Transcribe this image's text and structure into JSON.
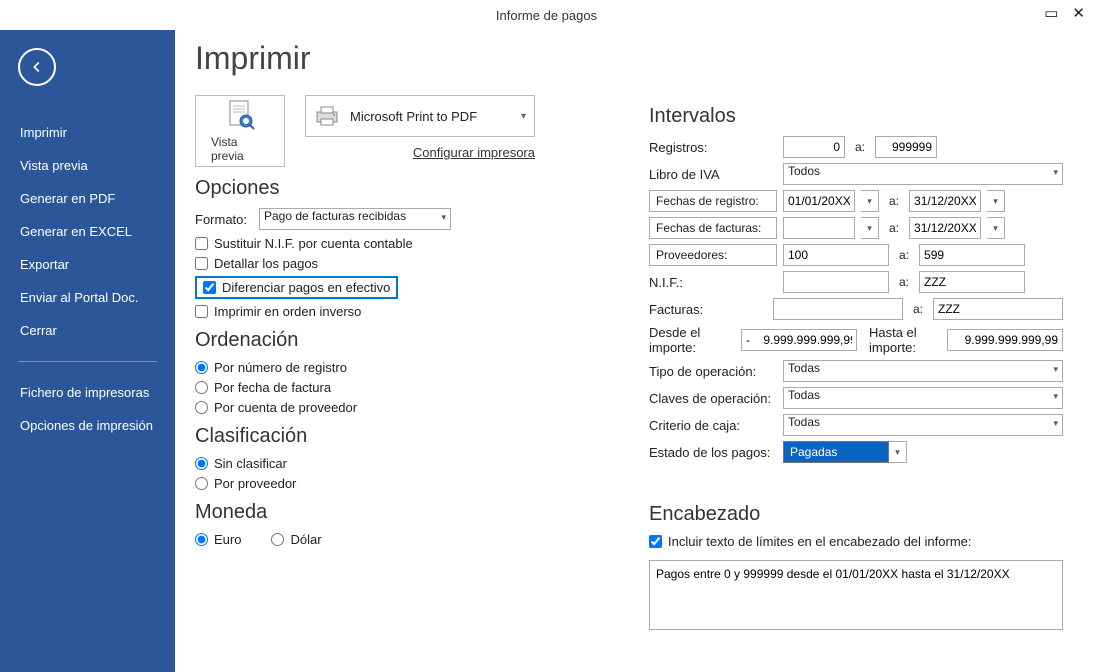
{
  "window": {
    "title": "Informe de pagos"
  },
  "sidebar": {
    "items": [
      {
        "label": "Imprimir"
      },
      {
        "label": "Vista previa"
      },
      {
        "label": "Generar en PDF"
      },
      {
        "label": "Generar en EXCEL"
      },
      {
        "label": "Exportar"
      },
      {
        "label": "Enviar al Portal Doc."
      },
      {
        "label": "Cerrar"
      }
    ],
    "items2": [
      {
        "label": "Fichero de impresoras"
      },
      {
        "label": "Opciones de impresión"
      }
    ]
  },
  "main": {
    "title": "Imprimir",
    "preview_label": "Vista previa",
    "printer": "Microsoft Print to PDF",
    "config_link": "Configurar impresora"
  },
  "opciones": {
    "heading": "Opciones",
    "formato_label": "Formato:",
    "formato_value": "Pago de facturas recibidas",
    "sustituir": "Sustituir N.I.F. por cuenta contable",
    "detallar": "Detallar los pagos",
    "diferenciar": "Diferenciar pagos en efectivo",
    "inverso": "Imprimir en orden inverso"
  },
  "ordenacion": {
    "heading": "Ordenación",
    "r1": "Por número de registro",
    "r2": "Por fecha de factura",
    "r3": "Por cuenta de proveedor"
  },
  "clasificacion": {
    "heading": "Clasificación",
    "r1": "Sin clasificar",
    "r2": "Por proveedor"
  },
  "moneda": {
    "heading": "Moneda",
    "r1": "Euro",
    "r2": "Dólar"
  },
  "intervalos": {
    "heading": "Intervalos",
    "registros_label": "Registros:",
    "registros_from": "0",
    "registros_to": "999999",
    "libro_label": "Libro de IVA",
    "libro_value": "Todos",
    "fechas_reg_btn": "Fechas de registro:",
    "fechas_reg_from": "01/01/20XX",
    "fechas_reg_to": "31/12/20XX",
    "fechas_fac_btn": "Fechas de facturas:",
    "fechas_fac_from": "",
    "fechas_fac_to": "31/12/20XX",
    "prov_btn": "Proveedores:",
    "prov_from": "100",
    "prov_to": "599",
    "nif_label": "N.I.F.:",
    "nif_from": "",
    "nif_to": "ZZZ",
    "facturas_label": "Facturas:",
    "facturas_from": "",
    "facturas_to": "ZZZ",
    "desde_imp_label": "Desde el importe:",
    "desde_imp": "-    9.999.999.999,99",
    "hasta_imp_label": "Hasta el importe:",
    "hasta_imp": "9.999.999.999,99",
    "tipo_label": "Tipo de operación:",
    "tipo_value": "Todas",
    "claves_label": "Claves de operación:",
    "claves_value": "Todas",
    "criterio_label": "Criterio de caja:",
    "criterio_value": "Todas",
    "estado_label": "Estado de los pagos:",
    "estado_value": "Pagadas",
    "a": "a:"
  },
  "encabezado": {
    "heading": "Encabezado",
    "incluir": "Incluir texto de límites en el encabezado del informe:",
    "text": "Pagos entre 0 y 999999 desde el 01/01/20XX hasta el 31/12/20XX"
  }
}
